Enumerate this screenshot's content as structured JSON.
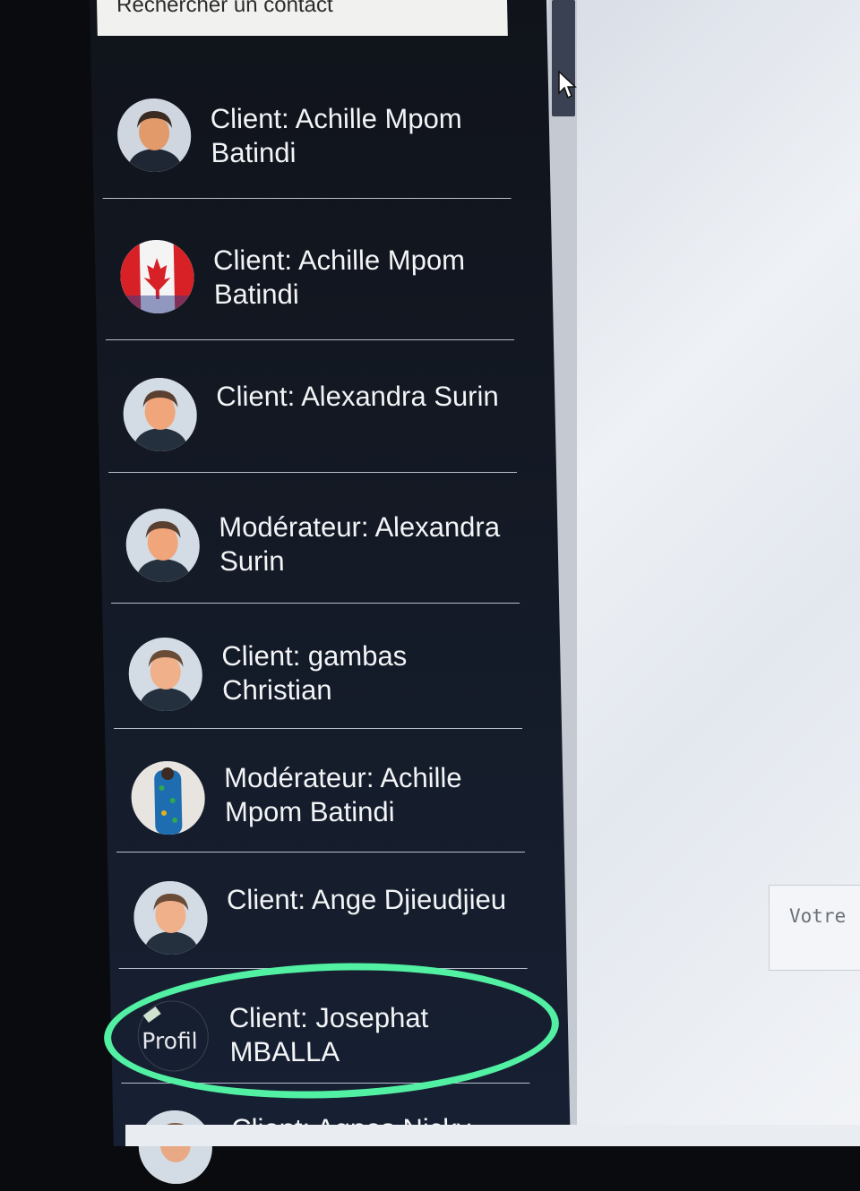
{
  "search": {
    "placeholder": "Rechercher un contact"
  },
  "contacts": [
    {
      "label": "Client: Achille Mpom Batindi",
      "avatar": "person-avatar-icon"
    },
    {
      "label": "Client: Achille Mpom Batindi",
      "avatar": "canada-flag-avatar-icon"
    },
    {
      "label": "Client: Alexandra Surin",
      "avatar": "person-avatar-icon"
    },
    {
      "label": "Modérateur: Alexandra Surin",
      "avatar": "person-avatar-icon"
    },
    {
      "label": "Client: gambas Christian",
      "avatar": "person-avatar-icon"
    },
    {
      "label": "Modérateur: Achille Mpom Batindi",
      "avatar": "photo-avatar-icon"
    },
    {
      "label": "Client: Ange Djieudjieu",
      "avatar": "person-avatar-icon"
    },
    {
      "label": "Client: Josephat MBALLA",
      "avatar": "broken-image-avatar-icon",
      "avatar_alt": "Profil"
    },
    {
      "label": "Client: Agnes Nicky",
      "avatar": "person-avatar-icon"
    }
  ],
  "message": {
    "placeholder": "Votre"
  },
  "colors": {
    "highlight": "#52f0a3",
    "sidebar": "#141a26",
    "text": "#f2f4f6"
  }
}
